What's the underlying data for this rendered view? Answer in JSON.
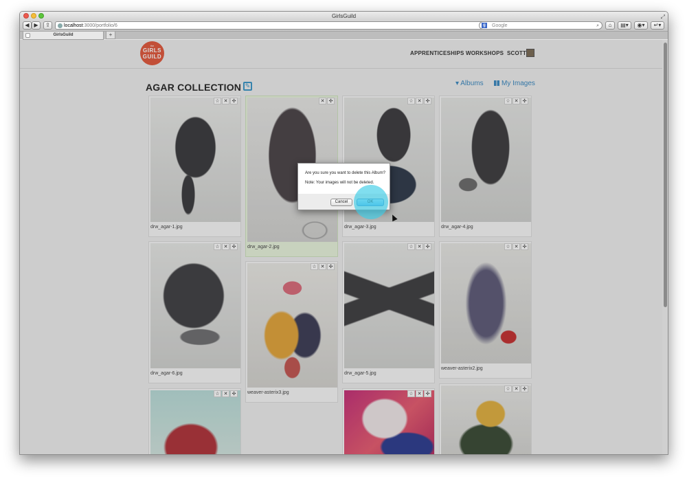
{
  "browser": {
    "window_title": "GirlsGuild",
    "url_host": "localhost",
    "url_path": ":3000/portfolio/6",
    "search_placeholder": "Google",
    "tab_title": "GirlsGuild",
    "new_tab_label": "+"
  },
  "site": {
    "logo_top": "the",
    "logo_line1": "GIRLS",
    "logo_line2": "GUILD",
    "nav": {
      "apprenticeships": "APPRENTICESHIPS",
      "workshops": "WORKSHOPS",
      "user": "SCOTT"
    }
  },
  "page": {
    "title": "AGAR COLLECTION",
    "albums_link": "Albums",
    "my_images_link": "My Images"
  },
  "images": [
    {
      "filename": "drw_agar-1.jpg",
      "actions": [
        "☆",
        "✕",
        "✣"
      ]
    },
    {
      "filename": "drw_agar-2.jpg",
      "actions": [
        "✕",
        "✣"
      ]
    },
    {
      "filename": "drw_agar-3.jpg",
      "actions": [
        "☆",
        "✕",
        "✣"
      ]
    },
    {
      "filename": "drw_agar-4.jpg",
      "actions": [
        "☆",
        "✕",
        "✣"
      ]
    },
    {
      "filename": "drw_agar-6.jpg",
      "actions": [
        "☆",
        "✕",
        "✣"
      ]
    },
    {
      "filename": "weaver-asterix3.jpg",
      "actions": [
        "☆",
        "✕",
        "✣"
      ]
    },
    {
      "filename": "drw_agar-5.jpg",
      "actions": [
        "☆",
        "✕",
        "✣"
      ]
    },
    {
      "filename": "weaver-asterix2.jpg",
      "actions": [
        "☆",
        "✕",
        "✣"
      ]
    },
    {
      "filename": "",
      "actions": [
        "☆",
        "✕",
        "✣"
      ]
    },
    {
      "filename": "",
      "actions": [
        "☆",
        "✕",
        "✣"
      ]
    },
    {
      "filename": "",
      "actions": [
        "☆",
        "✕",
        "✣"
      ]
    }
  ],
  "dialog": {
    "message": "Are you sure you want to delete this Album?",
    "note": "Note: Your images will not be deleted.",
    "cancel_label": "Cancel",
    "ok_label": "OK"
  },
  "colors": {
    "brand": "#e0573c",
    "link": "#3a88c0",
    "click_highlight": "#3ccde6"
  }
}
